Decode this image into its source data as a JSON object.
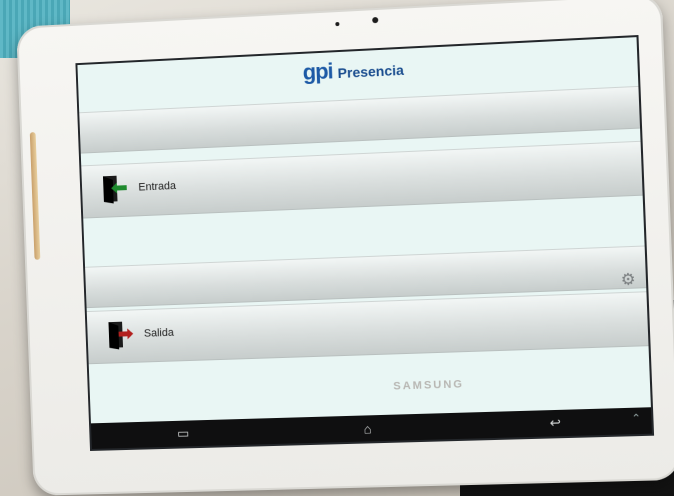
{
  "app": {
    "logo": "gpi",
    "title": "Presencia"
  },
  "actions": [
    {
      "label": "Entrada",
      "icon": "door-enter-icon",
      "arrow_color": "#1e8a2e"
    },
    {
      "label": "Salida",
      "icon": "door-exit-icon",
      "arrow_color": "#b2201e"
    }
  ],
  "device": {
    "brand": "SAMSUNG"
  },
  "nav_icons": [
    "recent-apps-icon",
    "home-icon",
    "back-icon"
  ],
  "colors": {
    "screen_bg": "#e9f6f4",
    "title": "#1a4d8f"
  }
}
